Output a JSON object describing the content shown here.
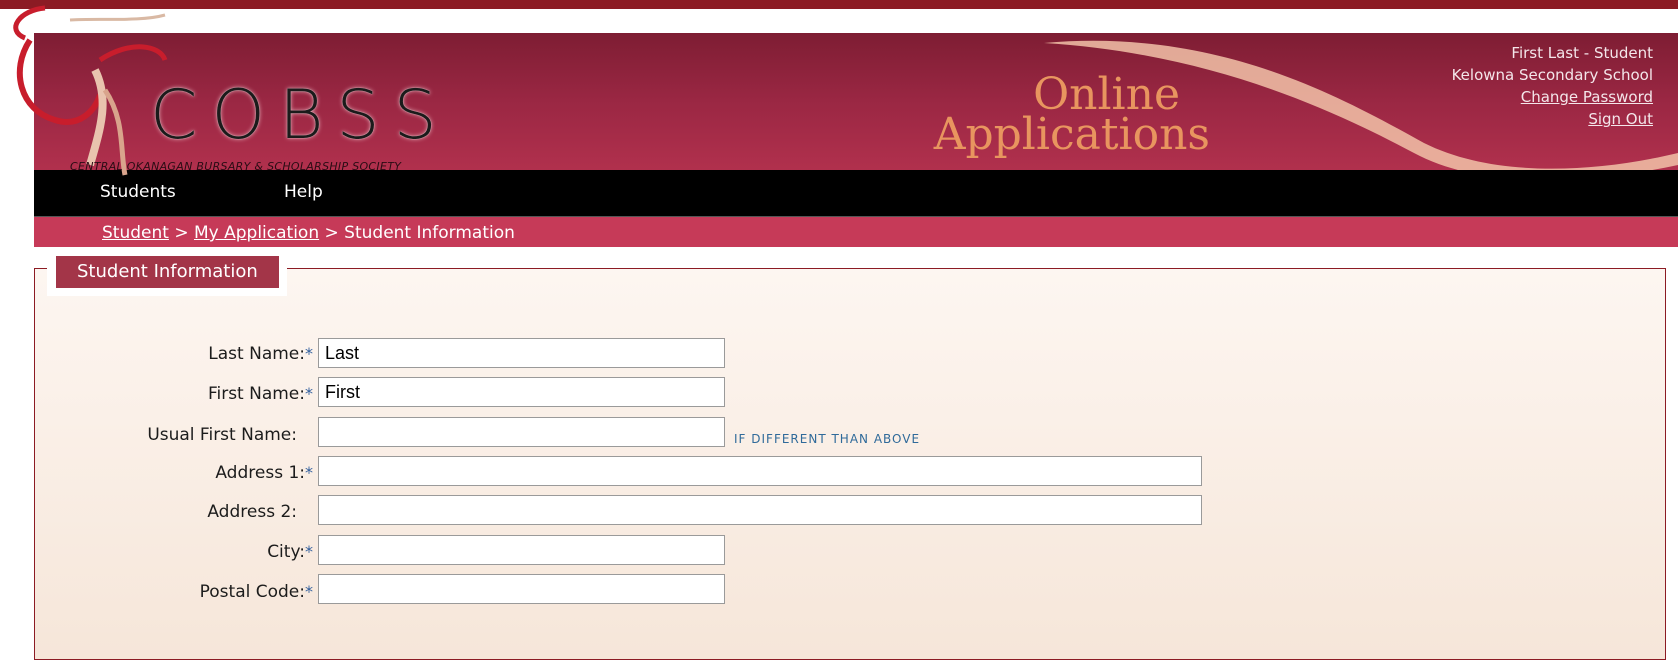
{
  "header": {
    "logo_text": "COBSS",
    "logo_subtitle": "CENTRAL OKANAGAN BURSARY & SCHOLARSHIP SOCIETY",
    "app_title_line1": "Online",
    "app_title_line2": "Applications",
    "user_name": "First Last - Student",
    "school": "Kelowna Secondary School",
    "change_password": "Change Password",
    "sign_out": "Sign Out"
  },
  "nav": {
    "items": [
      {
        "label": "Students"
      },
      {
        "label": "Help"
      }
    ]
  },
  "breadcrumb": {
    "item1": "Student",
    "sep1": " > ",
    "item2": "My Application",
    "sep2": " > ",
    "current": "Student Information"
  },
  "section": {
    "legend": "Student Information",
    "required_marker": "*",
    "fields": [
      {
        "label": "Last Name:",
        "required": true,
        "value": "Last"
      },
      {
        "label": "First Name:",
        "required": true,
        "value": "First"
      },
      {
        "label": "Usual First Name:",
        "required": false,
        "value": "",
        "hint": "IF DIFFERENT THAN ABOVE"
      },
      {
        "label": "Address 1:",
        "required": true,
        "value": ""
      },
      {
        "label": "Address 2:",
        "required": false,
        "value": ""
      },
      {
        "label": "City:",
        "required": true,
        "value": ""
      },
      {
        "label": "Postal Code:",
        "required": true,
        "value": ""
      }
    ]
  },
  "colors": {
    "header_top_bar": "#8c1b24",
    "header_bg": "#9a2743",
    "nav_bg": "#000000",
    "breadcrumb_bg": "#c63a58",
    "legend_bg": "#a33548",
    "required_star": "#2f5d9c",
    "hint_text": "#2f6a9a"
  }
}
